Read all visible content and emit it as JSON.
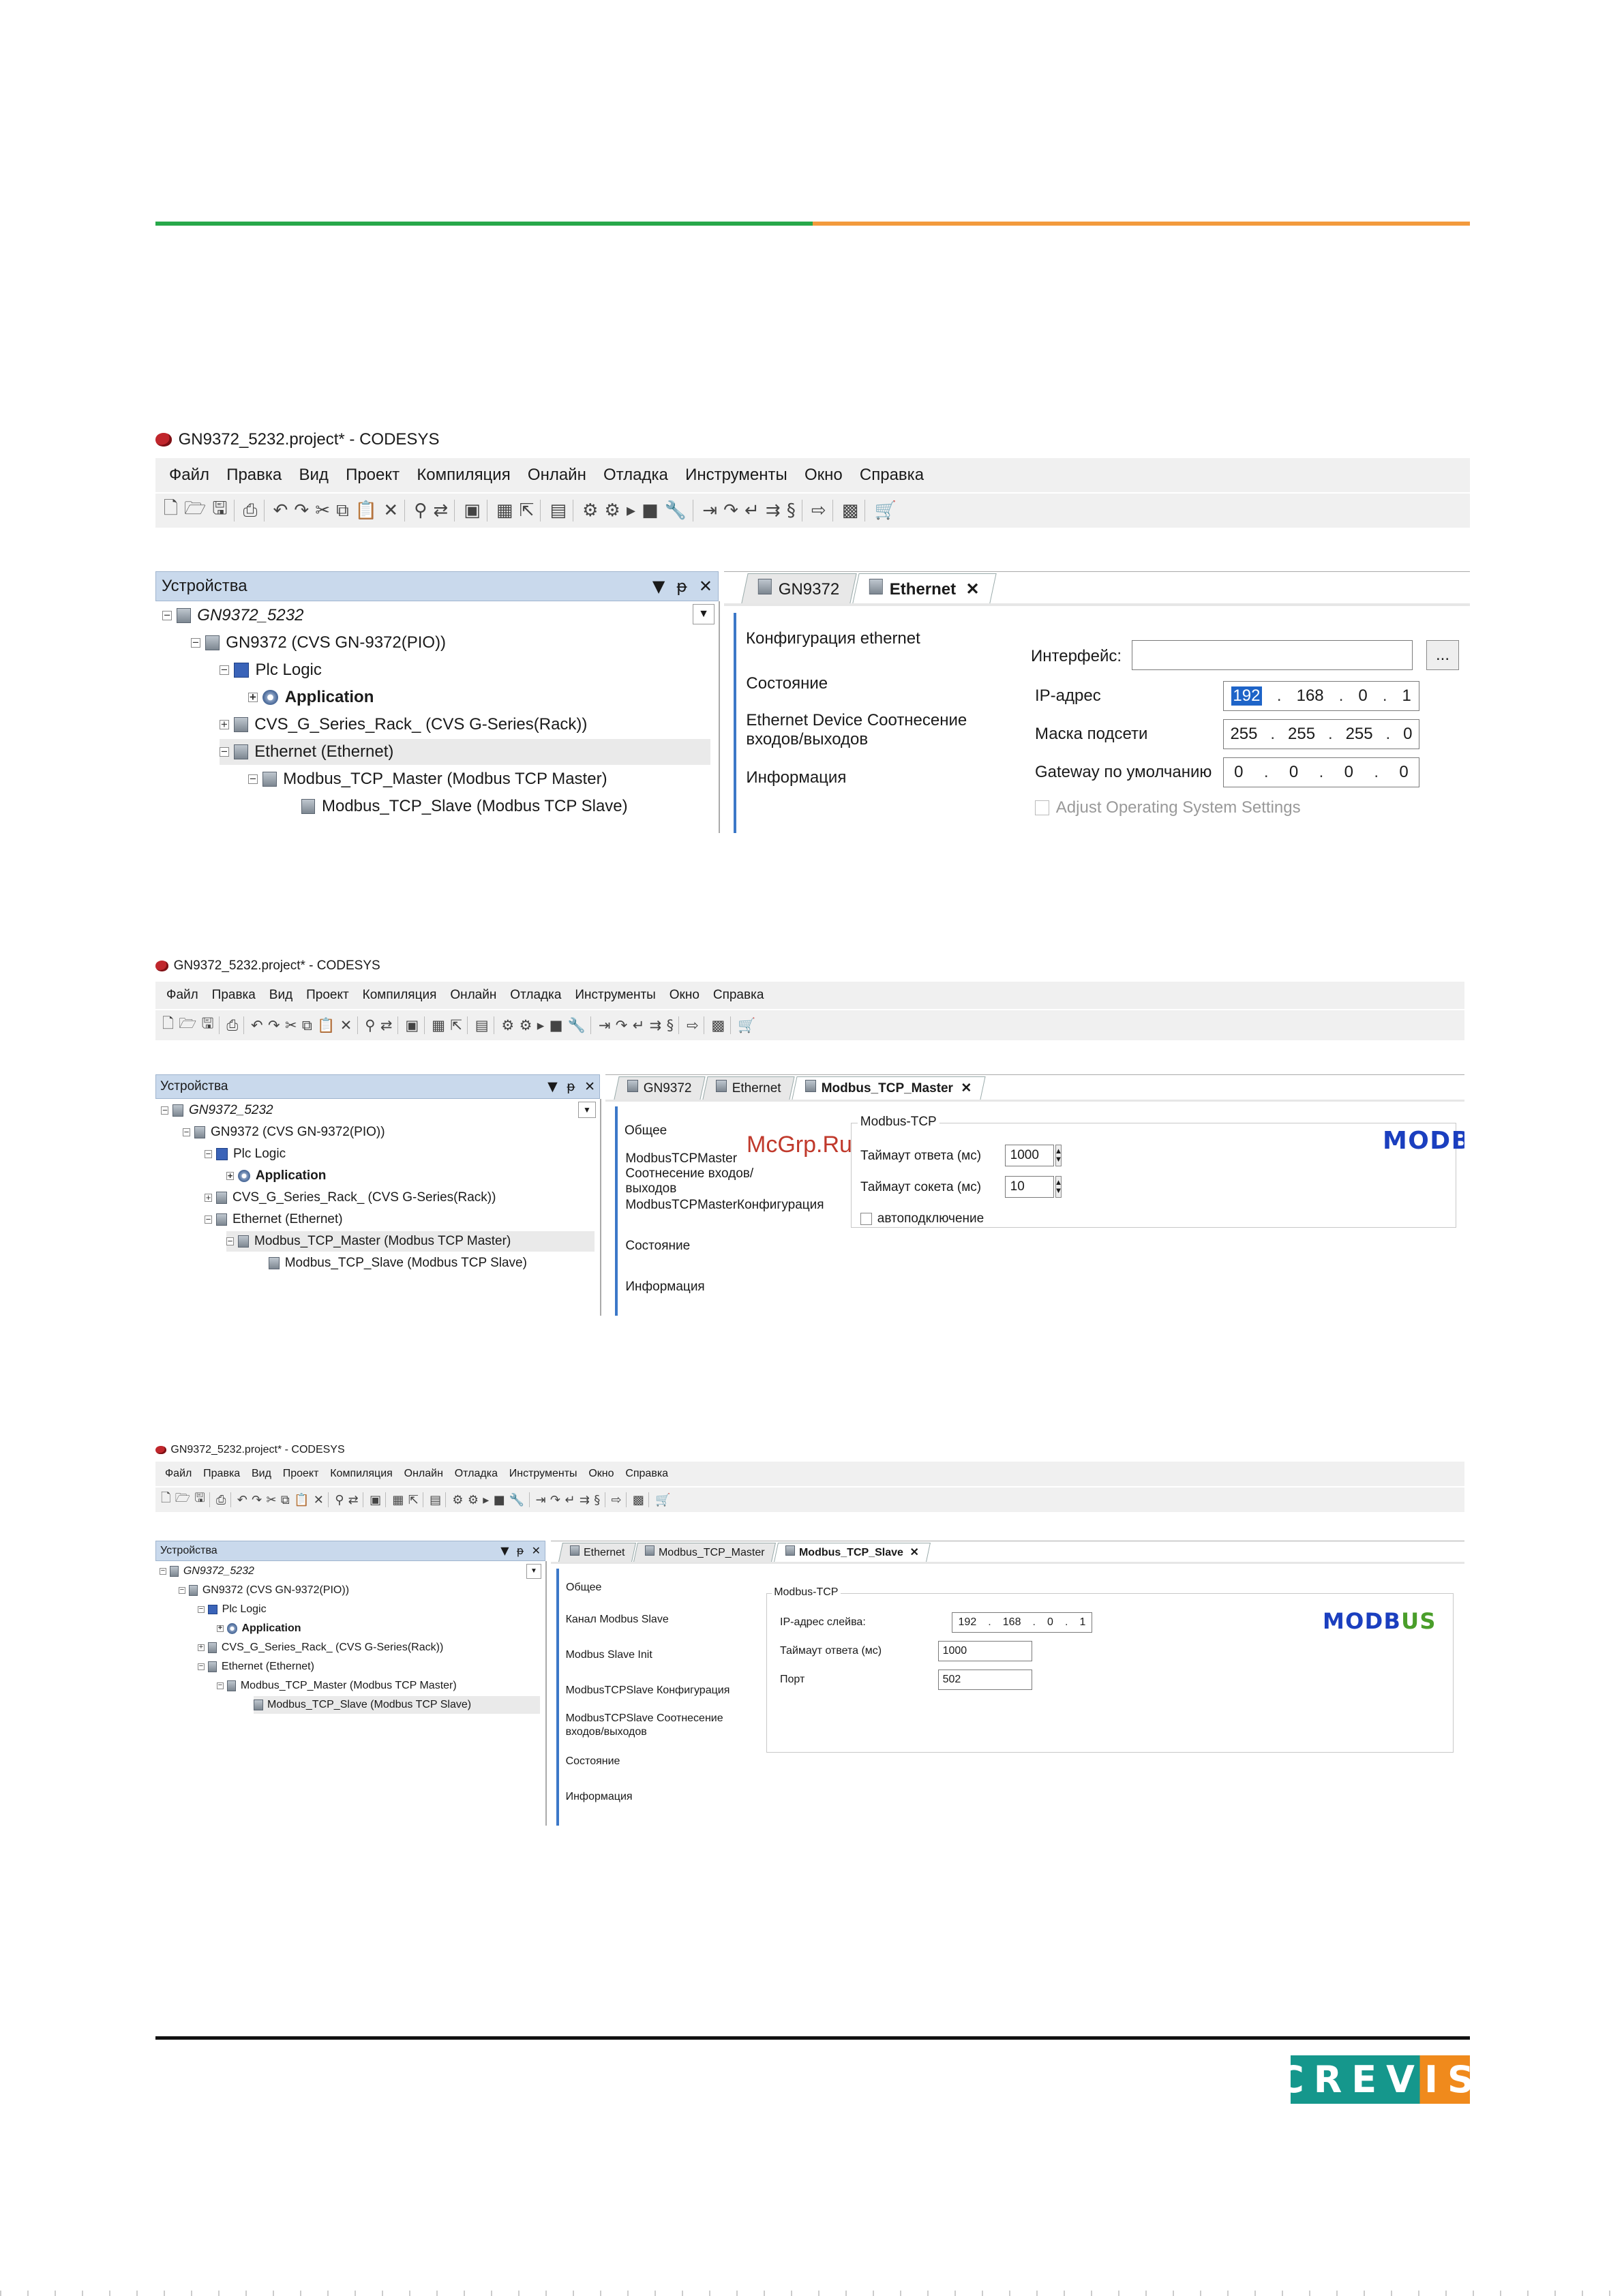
{
  "watermark": "McGrp.Ru",
  "logo": "CREVIS",
  "window_title": "GN9372_5232.project* - CODESYS",
  "menu": [
    "Файл",
    "Правка",
    "Вид",
    "Проект",
    "Компиляция",
    "Онлайн",
    "Отладка",
    "Инструменты",
    "Окно",
    "Справка"
  ],
  "devices_pane": {
    "title": "Устройства",
    "ctrl_menu": "▼",
    "ctrl_pin": "ᵽ",
    "ctrl_close": "✕"
  },
  "tree": {
    "project": "GN9372_5232",
    "plc": "GN9372 (CVS GN-9372(PIO))",
    "logic": "Plc Logic",
    "app": "Application",
    "rack": "CVS_G_Series_Rack_ (CVS G-Series(Rack))",
    "eth": "Ethernet (Ethernet)",
    "master": "Modbus_TCP_Master (Modbus TCP Master)",
    "slave": "Modbus_TCP_Slave (Modbus TCP Slave)"
  },
  "s1": {
    "tabs": [
      "GN9372",
      "Ethernet"
    ],
    "side": [
      "Конфигурация ethernet",
      "Состояние",
      "Ethernet Device Соотнесение входов/выходов",
      "Информация"
    ],
    "interface_label": "Интерфейс:",
    "interface_value": "",
    "ellipsis": "...",
    "ip_label": "IP-адрес",
    "ip": [
      "192",
      "168",
      "0",
      "1"
    ],
    "mask_label": "Маска подсети",
    "mask": [
      "255",
      "255",
      "255",
      "0"
    ],
    "gw_label": "Gateway по умолчанию",
    "gw": [
      "0",
      "0",
      "0",
      "0"
    ],
    "os_label": "Adjust Operating System Settings"
  },
  "s2": {
    "tabs": [
      "GN9372",
      "Ethernet",
      "Modbus_TCP_Master"
    ],
    "side": [
      "Общее",
      "ModbusTCPMaster Соотнесение входов/выходов",
      "ModbusTCPMasterКонфигурация",
      "Состояние",
      "Информация"
    ],
    "group": "Modbus-TCP",
    "timeout_label": "Таймаут ответа (мс)",
    "timeout": "1000",
    "socket_label": "Таймаут сокета (мс)",
    "socket": "10",
    "auto_label": "автоподключение"
  },
  "s3": {
    "tabs": [
      "Ethernet",
      "Modbus_TCP_Master",
      "Modbus_TCP_Slave"
    ],
    "side": [
      "Общее",
      "Канал Modbus Slave",
      "Modbus Slave Init",
      "ModbusTCPSlave Конфигурация",
      "ModbusTCPSlave Соотнесение входов/выходов",
      "Состояние",
      "Информация"
    ],
    "group": "Modbus-TCP",
    "ip_label": "IP-адрес слейва:",
    "ip": [
      "192",
      "168",
      "0",
      "1"
    ],
    "timeout_label": "Таймаут ответа (мс)",
    "timeout": "1000",
    "port_label": "Порт",
    "port": "502"
  },
  "modbus_logo": {
    "part1": "MODB",
    "part2": "US"
  }
}
